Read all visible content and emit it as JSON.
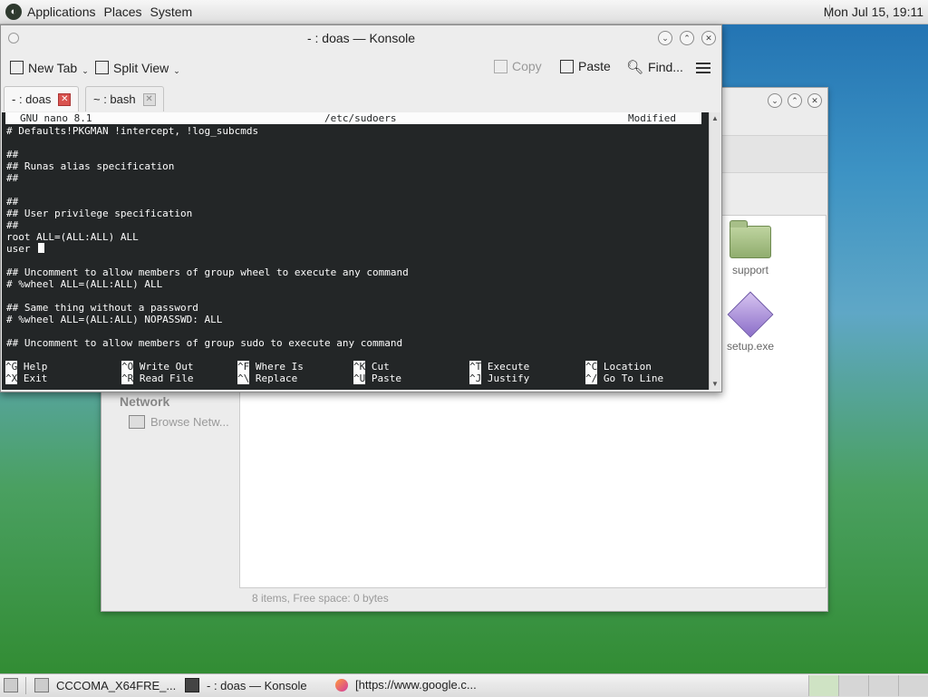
{
  "topbar": {
    "menus": [
      "Applications",
      "Places",
      "System"
    ],
    "clock": "Mon Jul 15, 19:11"
  },
  "file_manager": {
    "sidebar_network": "Network",
    "sidebar_browse": "Browse Netw...",
    "files": [
      {
        "name": "support",
        "icon": "folder-icon"
      },
      {
        "name": "setup.exe",
        "icon": "exe-icon"
      }
    ],
    "status": "8 items, Free space: 0 bytes"
  },
  "konsole": {
    "title": "- : doas — Konsole",
    "toolbar": {
      "new_tab": "New Tab",
      "split_view": "Split View",
      "copy": "Copy",
      "paste": "Paste",
      "find": "Find..."
    },
    "tabs": [
      {
        "label": "- : doas",
        "active": true
      },
      {
        "label": "~ : bash",
        "active": false
      }
    ],
    "nano": {
      "version": "GNU nano 8.1",
      "file": "/etc/sudoers",
      "state": "Modified",
      "lines": [
        "# Defaults!PKGMAN !intercept, !log_subcmds",
        "",
        "##",
        "## Runas alias specification",
        "##",
        "",
        "##",
        "## User privilege specification",
        "##",
        "root ALL=(ALL:ALL) ALL",
        "user ",
        "",
        "## Uncomment to allow members of group wheel to execute any command",
        "# %wheel ALL=(ALL:ALL) ALL",
        "",
        "## Same thing without a password",
        "# %wheel ALL=(ALL:ALL) NOPASSWD: ALL",
        "",
        "## Uncomment to allow members of group sudo to execute any command"
      ],
      "shortcuts": [
        {
          "key": "^G",
          "label": "Help"
        },
        {
          "key": "^O",
          "label": "Write Out"
        },
        {
          "key": "^F",
          "label": "Where Is"
        },
        {
          "key": "^K",
          "label": "Cut"
        },
        {
          "key": "^T",
          "label": "Execute"
        },
        {
          "key": "^C",
          "label": "Location"
        },
        {
          "key": "^X",
          "label": "Exit"
        },
        {
          "key": "^R",
          "label": "Read File"
        },
        {
          "key": "^\\",
          "label": "Replace"
        },
        {
          "key": "^U",
          "label": "Paste"
        },
        {
          "key": "^J",
          "label": "Justify"
        },
        {
          "key": "^/",
          "label": "Go To Line"
        }
      ]
    }
  },
  "taskbar": {
    "tasks": [
      {
        "label": "CCCOMA_X64FRE_...",
        "icon": "folder-icon"
      },
      {
        "label": "- : doas — Konsole",
        "icon": "terminal-icon"
      },
      {
        "label": "[https://www.google.c...",
        "icon": "firefox-icon"
      }
    ]
  }
}
